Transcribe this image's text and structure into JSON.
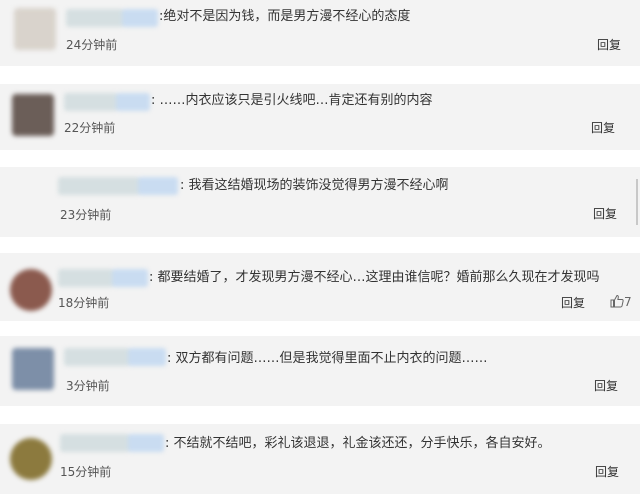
{
  "comments": [
    {
      "text": ":绝对不是因为钱，而是男方漫不经心的态度",
      "time": "24分钟前",
      "reply": "回复",
      "avatar_color": "#d9d3cc"
    },
    {
      "text": ": ……内衣应该只是引火线吧…肯定还有别的内容",
      "time": "22分钟前",
      "reply": "回复",
      "avatar_color": "#6b5e58"
    },
    {
      "text": ": 我看这结婚现场的装饰没觉得男方漫不经心啊",
      "time": "23分钟前",
      "reply": "回复",
      "avatar_color": "#c9c9c9"
    },
    {
      "text": ": 都要结婚了，才发现男方漫不经心…这理由谁信呢？婚前那么久现在才发现吗",
      "time": "18分钟前",
      "reply": "回复",
      "like": "7",
      "avatar_color": "#8b5a4e"
    },
    {
      "text": ": 双方都有问题……但是我觉得里面不止内衣的问题……",
      "time": "3分钟前",
      "reply": "回复",
      "avatar_color": "#7d8fa8"
    },
    {
      "text": ": 不结就不结吧，彩礼该退退，礼金该还还，分手快乐，各自安好。",
      "time": "15分钟前",
      "reply": "回复",
      "avatar_color": "#8c7a3e"
    }
  ]
}
